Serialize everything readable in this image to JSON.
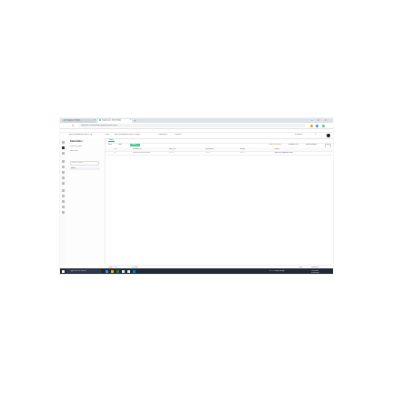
{
  "browser": {
    "tabs": [
      {
        "label": "Supabase Studio",
        "favicon_color": "#3ecf8e"
      },
      {
        "label": "Supabase | Table Editor",
        "favicon_color": "#3ecf8e"
      }
    ],
    "new_tab": "+",
    "window_controls": [
      "–",
      "□",
      "×"
    ],
    "url": "supabase.com/dashboard/project/table-editor",
    "nav": [
      "←",
      "→",
      "↻"
    ],
    "extension_colors": [
      "#f0a500",
      "#4285f4",
      "#3ecf8e"
    ]
  },
  "app": {
    "breadcrumbs": [
      "yusuf@supabase.com's Org",
      "Free",
      "yusuf@supabase.com's Project",
      "Production",
      "Connect"
    ],
    "header_actions": [
      "Feedback",
      "?",
      "⚙"
    ],
    "sidebar": {
      "title": "Table Editor",
      "schema_label": "schema: public",
      "new_table": "New table",
      "search_placeholder": "Search tables...",
      "tables": [
        "users"
      ]
    },
    "tabs": [
      "users"
    ],
    "toolbar": {
      "filter": "Filter",
      "sort": "Sort",
      "insert": "Insert",
      "rls": "Add RLS policy",
      "realtime": "Realtime off",
      "roles": "Role postgres",
      "definition": "Definition",
      "add": "+"
    },
    "grid": {
      "headers": [
        "id",
        "created_at",
        "user_id",
        "password",
        "name",
        "email"
      ],
      "rows": [
        [
          "1",
          "2025-01-15 09:21:44",
          "NULL",
          "NULL",
          "NULL",
          "yusuf@supabase.com"
        ]
      ]
    },
    "footer": {
      "pagination": "Page 1 of 1",
      "records": "1 record",
      "views": [
        "Data",
        "Definition"
      ]
    }
  },
  "taskbar": {
    "search_placeholder": "Type here to search",
    "weather": "29°C Partly cloudy",
    "time": "10:41 AM",
    "date": "1/15/2025",
    "app_colors": [
      "#f4f4f4",
      "#3c8ce7",
      "#f4b400",
      "#2e7d32",
      "#e8eaed",
      "#e8eaed",
      "#0078d4"
    ]
  }
}
